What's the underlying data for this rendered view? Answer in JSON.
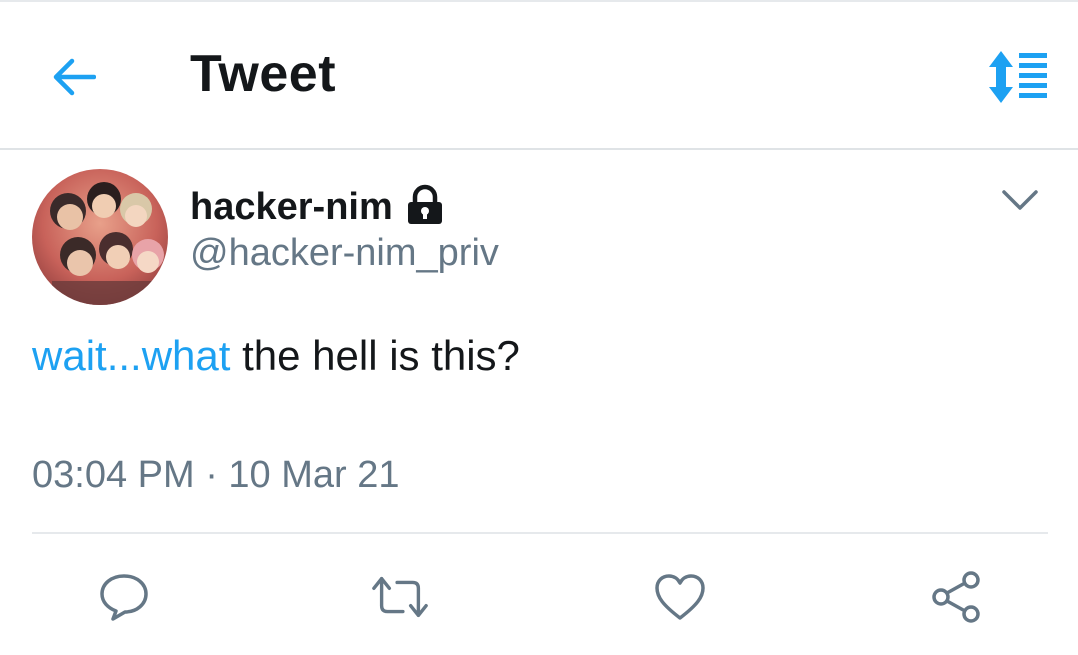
{
  "header": {
    "title": "Tweet",
    "back_icon": "arrow-left-icon",
    "sort_icon": "sort-lines-icon",
    "accent_color": "#1da1f2"
  },
  "tweet": {
    "author_name": "hacker-nim",
    "protected_icon": "lock-icon",
    "handle": "@hacker-nim_priv",
    "text_link": "wait...what",
    "text_rest": " the hell is this?",
    "timestamp": "03:04 PM · 10 Mar 21",
    "menu_icon": "chevron-down-icon"
  },
  "actions": [
    {
      "name": "reply",
      "icon": "comment-icon"
    },
    {
      "name": "retweet",
      "icon": "retweet-icon"
    },
    {
      "name": "like",
      "icon": "heart-icon"
    },
    {
      "name": "share",
      "icon": "share-icon"
    }
  ],
  "colors": {
    "text_primary": "#14171a",
    "text_secondary": "#657786",
    "link": "#1da1f2",
    "divider": "#e6e9ec"
  }
}
